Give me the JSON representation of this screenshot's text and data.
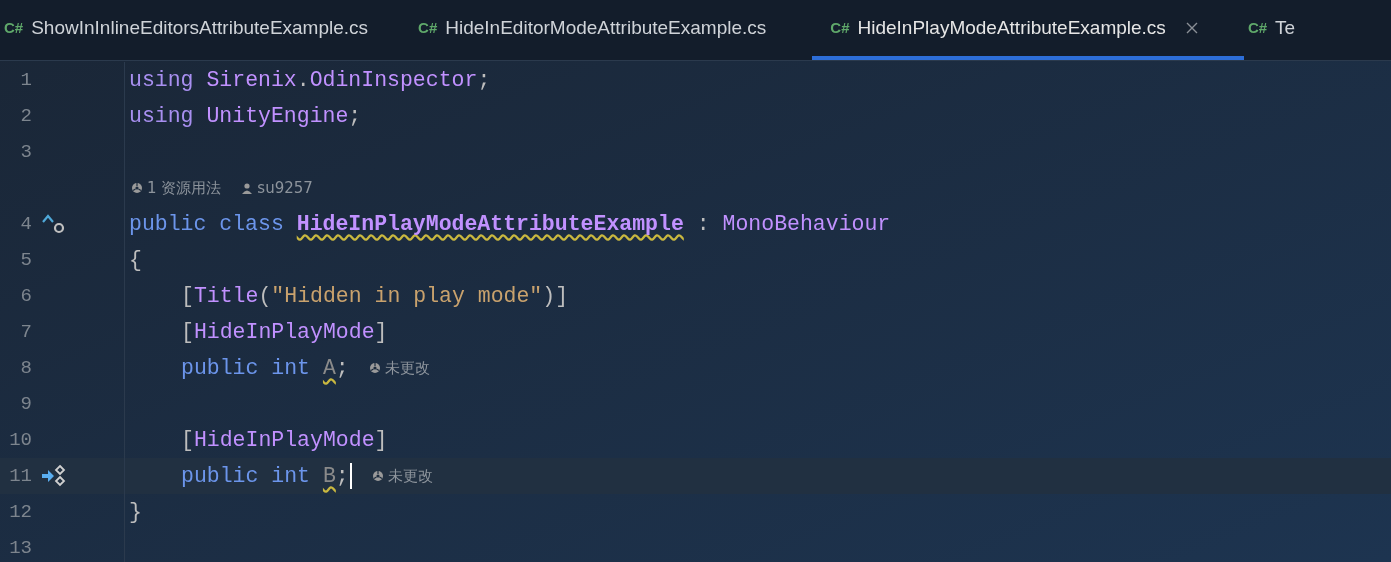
{
  "tabs": [
    {
      "lang": "C#",
      "label": "ShowInInlineEditorsAttributeExample.cs",
      "selected": false
    },
    {
      "lang": "C#",
      "label": "HideInEditorModeAttributeExample.cs",
      "selected": false
    },
    {
      "lang": "C#",
      "label": "HideInPlayModeAttributeExample.cs",
      "selected": true
    },
    {
      "lang": "C#",
      "label": "Te",
      "selected": false
    }
  ],
  "lines": [
    {
      "kind": "code",
      "number": "1",
      "current": false,
      "indented": false,
      "tokens": [
        {
          "kind": "directive",
          "text": "using "
        },
        {
          "kind": "type",
          "text": "Sirenix"
        },
        {
          "kind": "punct",
          "text": "."
        },
        {
          "kind": "type",
          "text": "OdinInspector"
        },
        {
          "kind": "punct",
          "text": ";"
        }
      ]
    },
    {
      "kind": "code",
      "number": "2",
      "current": false,
      "indented": false,
      "tokens": [
        {
          "kind": "directive",
          "text": "using "
        },
        {
          "kind": "type",
          "text": "UnityEngine"
        },
        {
          "kind": "punct",
          "text": ";"
        }
      ]
    },
    {
      "kind": "code",
      "number": "3",
      "current": false
    },
    {
      "kind": "hint",
      "usages": "1 资源用法",
      "author": "su9257"
    },
    {
      "kind": "code",
      "number": "4",
      "current": false,
      "indented": false,
      "marker": {
        "kind": "implemented"
      },
      "tokens": [
        {
          "kind": "keyword",
          "text": "public class "
        },
        {
          "kind": "declaration",
          "text": "HideInPlayModeAttributeExample"
        },
        {
          "kind": "punct",
          "text": " : "
        },
        {
          "kind": "type",
          "text": "MonoBehaviour"
        }
      ]
    },
    {
      "kind": "code",
      "number": "5",
      "current": false,
      "indented": false,
      "tokens": [
        {
          "kind": "punct",
          "text": "{"
        }
      ]
    },
    {
      "kind": "code",
      "number": "6",
      "current": false,
      "indented": true,
      "tokens": [
        {
          "kind": "punct",
          "text": "["
        },
        {
          "kind": "type",
          "text": "Title"
        },
        {
          "kind": "punct",
          "text": "("
        },
        {
          "kind": "string",
          "text": "\"Hidden in play mode\""
        },
        {
          "kind": "punct",
          "text": ")]"
        }
      ]
    },
    {
      "kind": "code",
      "number": "7",
      "current": false,
      "indented": true,
      "tokens": [
        {
          "kind": "punct",
          "text": "["
        },
        {
          "kind": "type",
          "text": "HideInPlayMode"
        },
        {
          "kind": "punct",
          "text": "]"
        }
      ]
    },
    {
      "kind": "code",
      "number": "8",
      "current": false,
      "indented": true,
      "hint": "未更改",
      "tokens": [
        {
          "kind": "keyword",
          "text": "public int "
        },
        {
          "kind": "unused",
          "text": "A"
        },
        {
          "kind": "punct",
          "text": ";"
        }
      ]
    },
    {
      "kind": "code",
      "number": "9",
      "current": false
    },
    {
      "kind": "code",
      "number": "10",
      "current": false,
      "indented": true,
      "tokens": [
        {
          "kind": "punct",
          "text": "["
        },
        {
          "kind": "type",
          "text": "HideInPlayMode"
        },
        {
          "kind": "punct",
          "text": "]"
        }
      ]
    },
    {
      "kind": "code",
      "number": "11",
      "current": true,
      "indented": true,
      "marker": {
        "kind": "serialized"
      },
      "hint": "未更改",
      "tokens": [
        {
          "kind": "keyword",
          "text": "public int "
        },
        {
          "kind": "unused",
          "text": "B"
        },
        {
          "kind": "punct",
          "text": ";"
        }
      ]
    },
    {
      "kind": "code",
      "number": "12",
      "current": false,
      "indented": false,
      "tokens": [
        {
          "kind": "punct",
          "text": "}"
        }
      ]
    },
    {
      "kind": "code",
      "number": "13",
      "current": false
    }
  ]
}
